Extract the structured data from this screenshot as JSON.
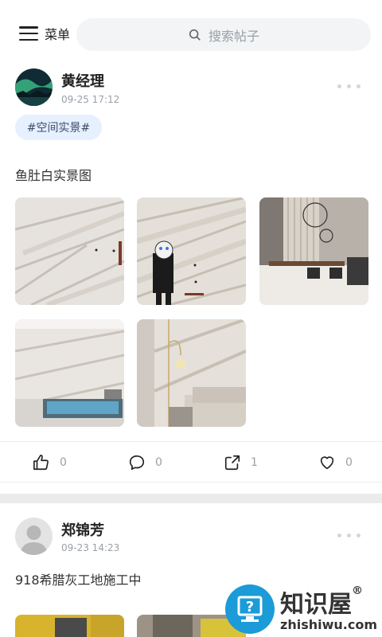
{
  "header": {
    "menu_label": "菜单",
    "search_placeholder": "搜索帖子"
  },
  "posts": [
    {
      "author": "黄经理",
      "time": "09-25 17:12",
      "tag": "#空间实景#",
      "content": "鱼肚白实景图",
      "images": [
        "marble-wall",
        "person-marble-wall",
        "dining-room",
        "pool-room",
        "living-room"
      ],
      "actions": {
        "like": "0",
        "comment": "0",
        "share": "1",
        "favorite": "0"
      }
    },
    {
      "author": "郑锦芳",
      "time": "09-23 14:23",
      "content": "918希腊灰工地施工中"
    }
  ],
  "watermark": {
    "title": "知识屋",
    "reg": "®",
    "url": "zhishiwu.com"
  }
}
